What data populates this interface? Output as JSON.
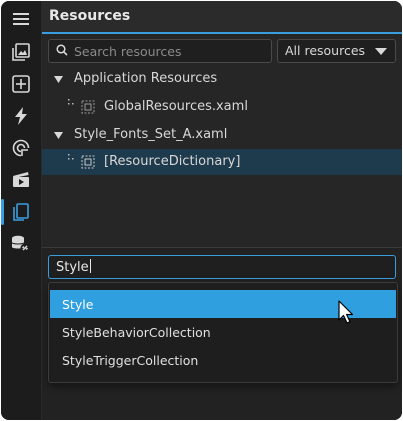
{
  "panel": {
    "title": "Resources"
  },
  "search": {
    "placeholder": "Search resources"
  },
  "filter": {
    "selected": "All resources"
  },
  "tree": {
    "groups": [
      {
        "label": "Application Resources",
        "children": [
          "GlobalResources.xaml"
        ]
      },
      {
        "label": "Style_Fonts_Set_A.xaml",
        "children": [
          "[ResourceDictionary]"
        ]
      }
    ]
  },
  "combo": {
    "value": "Style"
  },
  "dropdown": {
    "options": [
      "Style",
      "StyleBehaviorCollection",
      "StyleTriggerCollection"
    ]
  },
  "rail": {
    "icons": [
      "hamburger-menu-icon",
      "assets-icon",
      "add-icon",
      "lightning-icon",
      "data-source-icon",
      "animation-icon",
      "resources-icon",
      "database-link-icon"
    ]
  },
  "colors": {
    "accent": "#3a9ddd",
    "highlight": "#2f9fe0",
    "selected_row": "#1e3a4d",
    "background": "#262626"
  }
}
